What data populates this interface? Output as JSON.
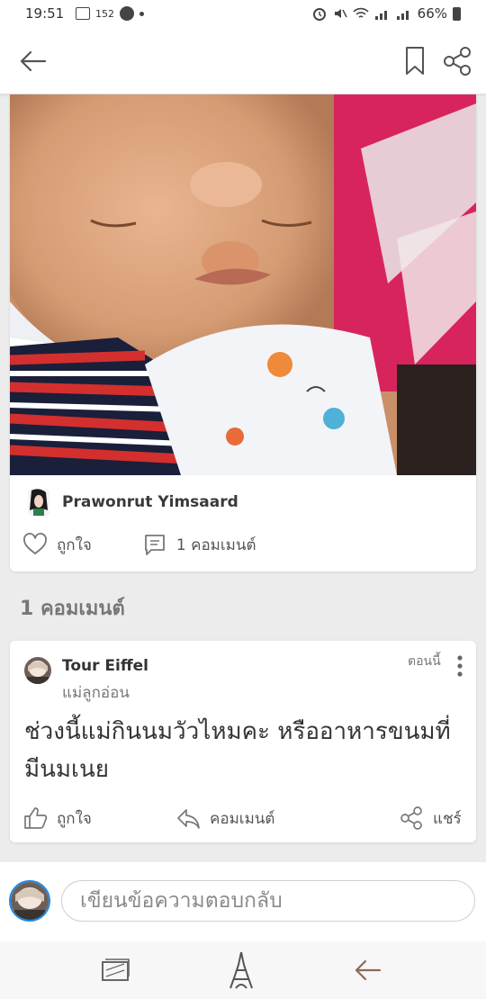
{
  "status_bar": {
    "time": "19:51",
    "notification_count": "152",
    "battery_percent": "66%"
  },
  "app_bar": {
    "icons": [
      "back-arrow-icon",
      "bookmark-icon",
      "share-icon"
    ]
  },
  "post": {
    "author_name": "Prawonrut Yimsaard",
    "like_label": "ถูกใจ",
    "comment_count_label": "1 คอมเมนต์"
  },
  "comments_section": {
    "heading": "1 คอมเมนต์",
    "comments": [
      {
        "author_name": "Tour Eiffel",
        "author_role": "แม่ลูกอ่อน",
        "time": "ตอนนี้",
        "text": "ช่วงนี้แม่กินนมวัวไหมคะ หรืออาหารขนมที่มีนมเนย",
        "like_label": "ถูกใจ",
        "reply_label": "คอมเมนต์",
        "share_label": "แชร์"
      }
    ]
  },
  "reply": {
    "placeholder": "เขียนข้อความตอบกลับ"
  },
  "colors": {
    "accent_blue": "#1e88e5",
    "background": "#ececec",
    "card": "#ffffff"
  }
}
